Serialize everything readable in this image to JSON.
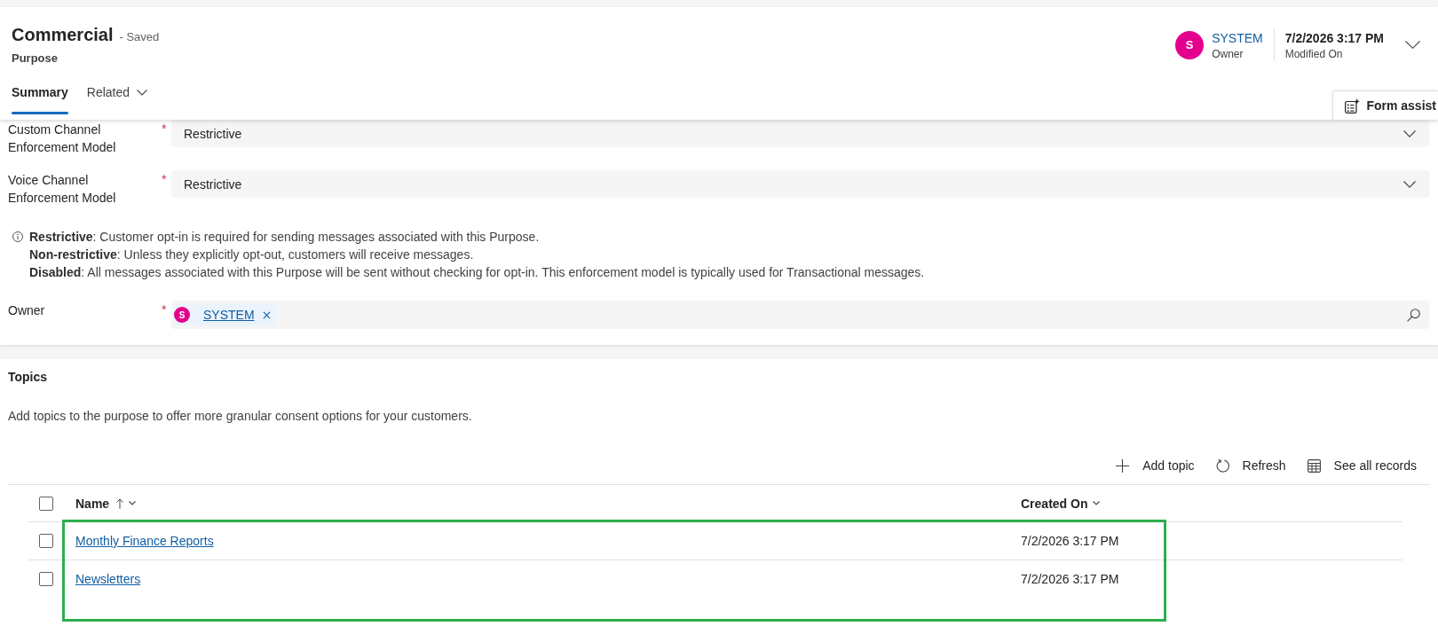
{
  "header": {
    "title": "Commercial",
    "status": "- Saved",
    "entity": "Purpose",
    "owner": {
      "initial": "S",
      "name": "SYSTEM",
      "label": "Owner"
    },
    "modified": {
      "value": "7/2/2026 3:17 PM",
      "label": "Modified On"
    },
    "form_assist": "Form assist"
  },
  "tabs": [
    {
      "label": "Summary",
      "selected": true,
      "dropdown": false
    },
    {
      "label": "Related",
      "selected": false,
      "dropdown": true
    }
  ],
  "form": {
    "required_mark": "*",
    "fields": [
      {
        "kind": "select",
        "label": "Custom Channel Enforcement Model",
        "required": true,
        "value": "Restrictive"
      },
      {
        "kind": "select",
        "label": "Voice Channel Enforcement Model",
        "required": true,
        "value": "Restrictive"
      },
      {
        "kind": "note",
        "lines": [
          "**Restrictive**: Customer opt-in is required for sending messages associated with this Purpose.",
          "**Non-restrictive**: Unless they explicitly opt-out, customers will receive messages.",
          "**Disabled**: All messages associated with this Purpose will be sent without checking for opt-in. This enforcement model is typically used for Transactional messages."
        ]
      },
      {
        "kind": "lookup",
        "label": "Owner",
        "required": true,
        "value": {
          "initial": "S",
          "name": "SYSTEM"
        }
      }
    ]
  },
  "topics": {
    "title": "Topics",
    "description": "Add topics to the purpose to offer more granular consent options for your customers.",
    "commands": [
      {
        "kind": "add",
        "label": "Add topic"
      },
      {
        "kind": "refresh",
        "label": "Refresh"
      },
      {
        "kind": "view_all",
        "label": "See all records"
      }
    ],
    "grid": {
      "all_checked": false,
      "highlighted": true,
      "columns": [
        {
          "label": "Name",
          "sorted": true
        },
        {
          "label": "Created On",
          "sorted": false
        }
      ],
      "rows": [
        {
          "checked": false,
          "name": "Monthly Finance Reports",
          "created_on": "7/2/2026 3:17 PM"
        },
        {
          "checked": false,
          "name": "Newsletters",
          "created_on": "7/2/2026 3:17 PM"
        }
      ]
    }
  }
}
